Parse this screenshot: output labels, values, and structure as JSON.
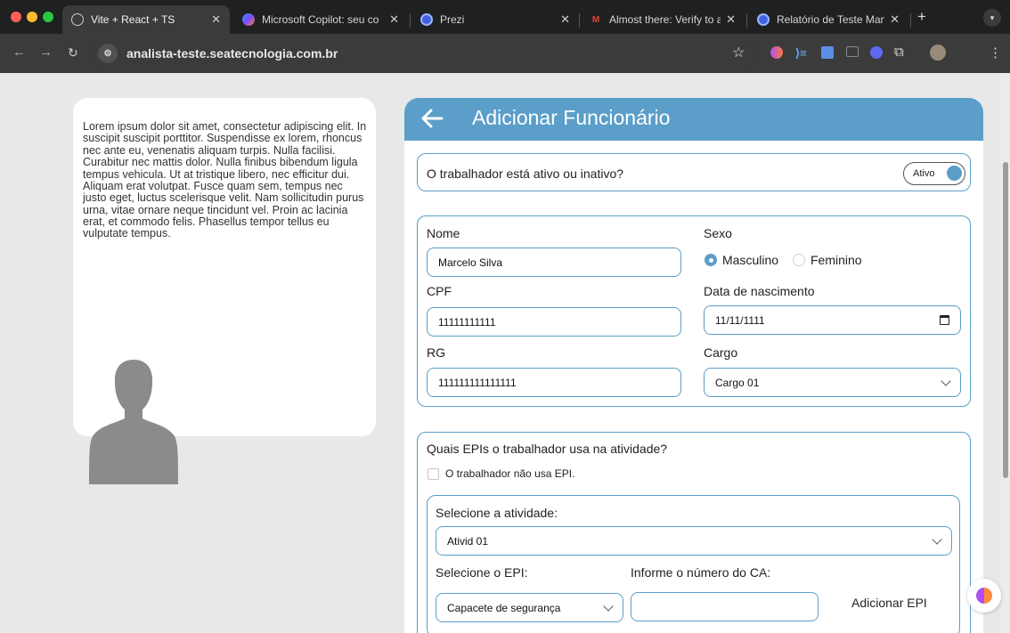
{
  "browser": {
    "tabs": [
      {
        "title": "Vite + React + TS",
        "active": true,
        "icon": "globe-icon"
      },
      {
        "title": "Microsoft Copilot: seu co",
        "active": false,
        "icon": "copilot-icon"
      },
      {
        "title": "Prezi",
        "active": false,
        "icon": "prezi-icon"
      },
      {
        "title": "Almost there: Verify to as",
        "active": false,
        "icon": "gmail-icon"
      },
      {
        "title": "Relatório de Teste Manua",
        "active": false,
        "icon": "prezi-icon"
      }
    ],
    "new_tab": "+",
    "url": "analista-teste.seatecnologia.com.br"
  },
  "sidebar": {
    "description": "Lorem ipsum dolor sit amet, consectetur adipiscing elit. In suscipit suscipit porttitor. Suspendisse ex lorem, rhoncus nec ante eu, venenatis aliquam turpis. Nulla facilisi. Curabitur nec mattis dolor. Nulla finibus bibendum ligula tempus vehicula. Ut at tristique libero, nec efficitur dui. Aliquam erat volutpat. Fusce quam sem, tempus nec justo eget, luctus scelerisque velit. Nam sollicitudin purus urna, vitae ornare neque tincidunt vel. Proin ac lacinia erat, et commodo felis. Phasellus tempor tellus eu vulputate tempus."
  },
  "form": {
    "title": "Adicionar Funcionário",
    "status": {
      "question": "O trabalhador está ativo ou inativo?",
      "toggle_label": "Ativo",
      "active": true
    },
    "fields": {
      "name_label": "Nome",
      "name_value": "Marcelo Silva",
      "sex_label": "Sexo",
      "sex_options": [
        "Masculino",
        "Feminino"
      ],
      "sex_selected": "Masculino",
      "cpf_label": "CPF",
      "cpf_value": "11111111111",
      "birth_label": "Data de nascimento",
      "birth_value": "11/11/1111",
      "rg_label": "RG",
      "rg_value": "111111111111111",
      "role_label": "Cargo",
      "role_value": "Cargo 01"
    },
    "epi": {
      "question": "Quais EPIs o trabalhador usa na atividade?",
      "no_epi_label": "O trabalhador não usa EPI.",
      "activity_label": "Selecione a atividade:",
      "activity_value": "Ativid 01",
      "epi_label": "Selecione o EPI:",
      "epi_value": "Capacete de segurança",
      "ca_label": "Informe o número do CA:",
      "ca_value": "",
      "add_button": "Adicionar EPI"
    }
  },
  "colors": {
    "accent": "#5b9ec9",
    "page_bg": "#e8e8e8",
    "chrome_bg": "#1f2020",
    "toolbar_bg": "#3b3b3b"
  }
}
